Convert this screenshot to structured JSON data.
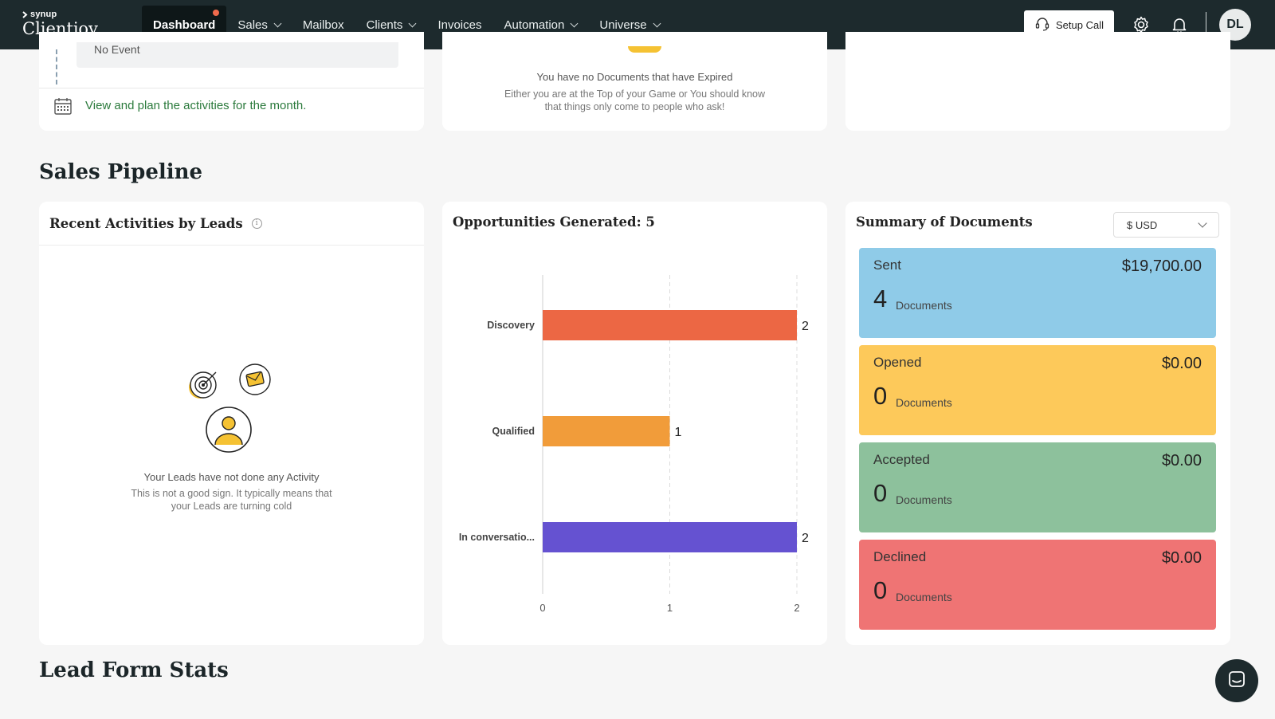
{
  "nav": {
    "logo_top": "synup",
    "logo_brand": "Clientjoy",
    "items": [
      {
        "label": "Dashboard",
        "active": true,
        "dot": true,
        "dropdown": false
      },
      {
        "label": "Sales",
        "dropdown": true
      },
      {
        "label": "Mailbox",
        "dropdown": false
      },
      {
        "label": "Clients",
        "dropdown": true
      },
      {
        "label": "Invoices",
        "dropdown": false
      },
      {
        "label": "Automation",
        "dropdown": true
      },
      {
        "label": "Universe",
        "dropdown": true
      }
    ],
    "setup_call": "Setup Call",
    "avatar_initials": "DL",
    "colors": {
      "bg": "#1d2a2d",
      "active_bg": "#0e1718",
      "dot": "#ef6a4c"
    }
  },
  "top_cards": {
    "events": {
      "no_event": "No Event",
      "plan_link": "View and plan the activities for the month."
    },
    "expired": {
      "title": "You have no Documents that have Expired",
      "subtitle": "Either you are at the Top of your Game or You should know that things only come to people who ask!"
    }
  },
  "sales_pipeline": {
    "title": "Sales Pipeline",
    "recent_activities": {
      "title": "Recent Activities by Leads",
      "empty_title": "Your Leads have not done any Activity",
      "empty_subtitle": "This is not a good sign. It typically means that your Leads are turning cold"
    },
    "opportunities": {
      "title": "Opportunities Generated: 5"
    },
    "documents": {
      "title": "Summary of Documents",
      "currency": "$ USD",
      "tiles": [
        {
          "label": "Sent",
          "amount": "$19,700.00",
          "count": "4",
          "unit": "Documents",
          "color": "#8fcbe8"
        },
        {
          "label": "Opened",
          "amount": "$0.00",
          "count": "0",
          "unit": "Documents",
          "color": "#fdc95a"
        },
        {
          "label": "Accepted",
          "amount": "$0.00",
          "count": "0",
          "unit": "Documents",
          "color": "#8dc19c"
        },
        {
          "label": "Declined",
          "amount": "$0.00",
          "count": "0",
          "unit": "Documents",
          "color": "#ef7474"
        }
      ]
    }
  },
  "lead_form_stats": {
    "title": "Lead Form Stats"
  },
  "chart_data": {
    "type": "bar",
    "orientation": "horizontal",
    "categories": [
      "Discovery",
      "Qualified",
      "In conversatio..."
    ],
    "values": [
      2,
      1,
      2
    ],
    "colors": [
      "#ec6744",
      "#f19c3a",
      "#6552d1"
    ],
    "x_ticks": [
      "0",
      "1",
      "2"
    ],
    "xlim": [
      0,
      2
    ],
    "grid": "dashed vertical"
  }
}
